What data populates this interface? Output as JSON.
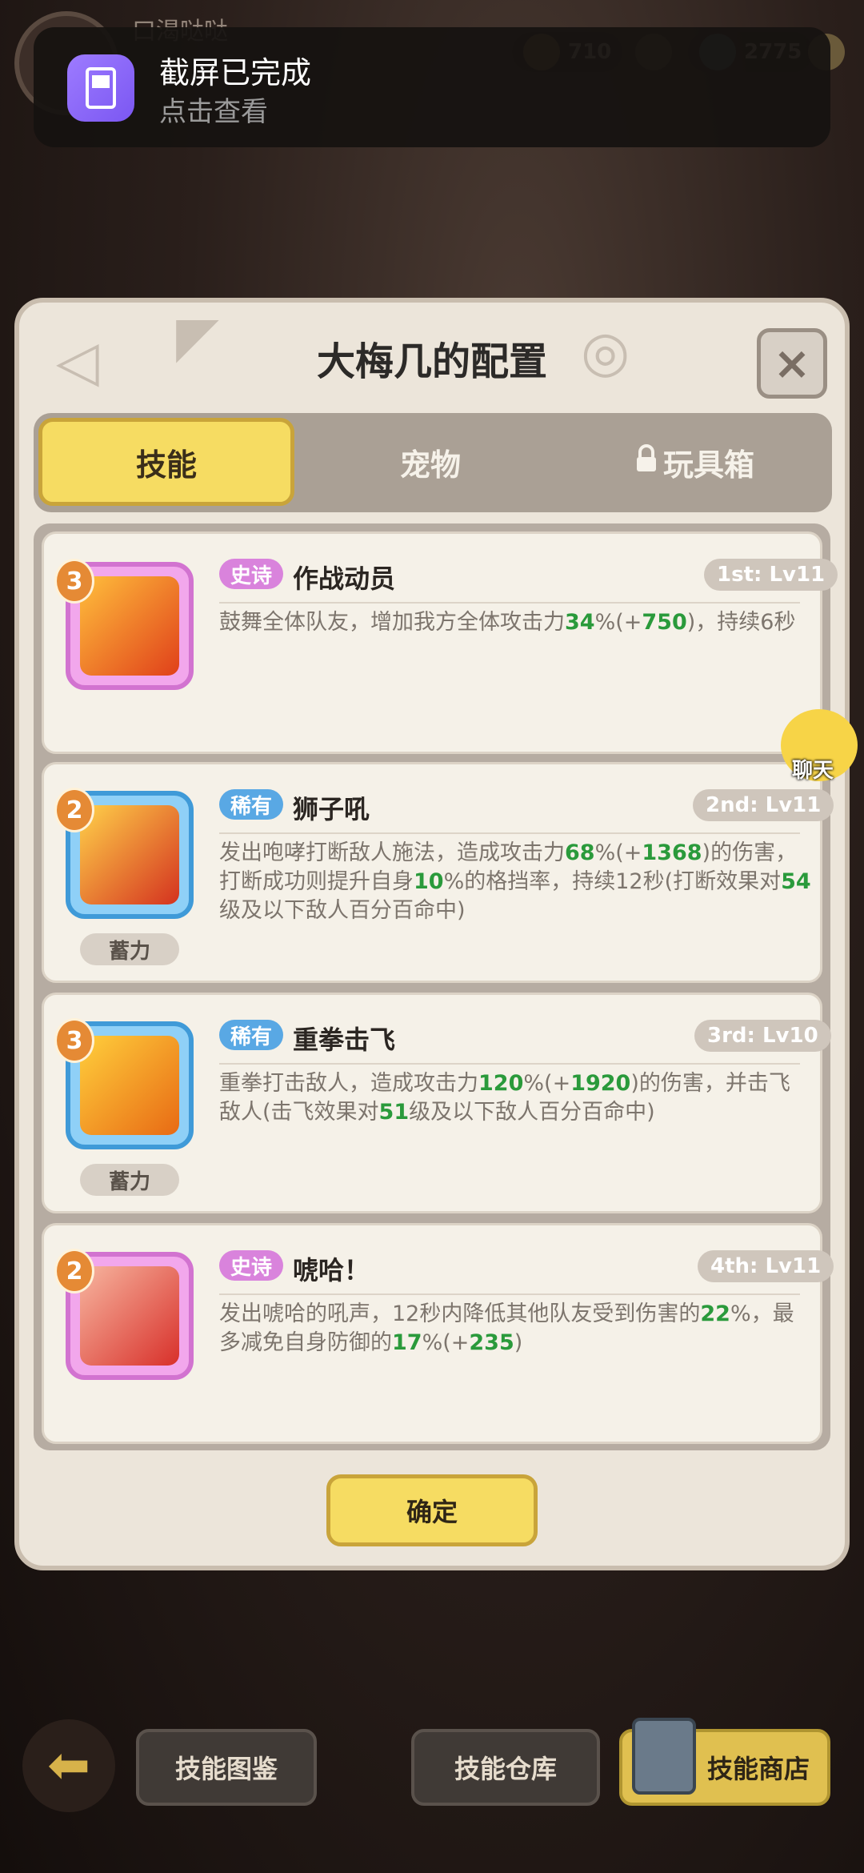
{
  "hud": {
    "player_name": "口渴哒哒",
    "resource1": "710",
    "resource2": "2775"
  },
  "notification": {
    "title": "截屏已完成",
    "subtitle": "点击查看"
  },
  "dialog": {
    "title": "大梅几的配置",
    "close": "×",
    "tabs": [
      {
        "label": "技能",
        "active": true
      },
      {
        "label": "宠物",
        "active": false
      },
      {
        "label": "玩具箱",
        "active": false,
        "locked": true
      }
    ],
    "confirm": "确定"
  },
  "skills": [
    {
      "level": "3",
      "rarity": "史诗",
      "rarity_type": "epic",
      "name": "作战动员",
      "slot": "1st: Lv11",
      "charge": "",
      "desc": [
        {
          "t": "鼓舞全体队友，增加我方全体攻击力"
        },
        {
          "t": "34",
          "g": true
        },
        {
          "t": "%(+"
        },
        {
          "t": "750",
          "g": true
        },
        {
          "t": ")，持续6秒"
        }
      ],
      "icon_color": "#e85a1c"
    },
    {
      "level": "2",
      "rarity": "稀有",
      "rarity_type": "rare",
      "name": "狮子吼",
      "slot": "2nd: Lv11",
      "charge": "蓄力",
      "desc": [
        {
          "t": "发出咆哮打断敌人施法，造成攻击力"
        },
        {
          "t": "68",
          "g": true
        },
        {
          "t": "%(+"
        },
        {
          "t": "1368",
          "g": true
        },
        {
          "t": ")的伤害，打断成功则提升自身"
        },
        {
          "t": "10",
          "g": true
        },
        {
          "t": "%的格挡率，持续12秒(打断效果对"
        },
        {
          "t": "54",
          "g": true
        },
        {
          "t": "级及以下敌人百分百命中)"
        }
      ],
      "icon_color": "#f0a020"
    },
    {
      "level": "3",
      "rarity": "稀有",
      "rarity_type": "rare",
      "name": "重拳击飞",
      "slot": "3rd: Lv10",
      "charge": "蓄力",
      "desc": [
        {
          "t": "重拳打击敌人，造成攻击力"
        },
        {
          "t": "120",
          "g": true
        },
        {
          "t": "%(+"
        },
        {
          "t": "1920",
          "g": true
        },
        {
          "t": ")的伤害，并击飞敌人(击飞效果对"
        },
        {
          "t": "51",
          "g": true
        },
        {
          "t": "级及以下敌人百分百命中)"
        }
      ],
      "icon_color": "#e8801c"
    },
    {
      "level": "2",
      "rarity": "史诗",
      "rarity_type": "epic",
      "name": "唬哈！",
      "slot": "4th: Lv11",
      "charge": "",
      "desc": [
        {
          "t": "发出唬哈的吼声，12秒内降低其他队友受到伤害的"
        },
        {
          "t": "22",
          "g": true
        },
        {
          "t": "%，最多减免自身防御的"
        },
        {
          "t": "17",
          "g": true
        },
        {
          "t": "%(+"
        },
        {
          "t": "235",
          "g": true
        },
        {
          "t": ")"
        }
      ],
      "icon_color": "#e0403a"
    }
  ],
  "chat": "聊天",
  "bottom": {
    "back": "⬅",
    "btn1": "技能图鉴",
    "btn2": "技能仓库",
    "btn3": "技能商店"
  }
}
